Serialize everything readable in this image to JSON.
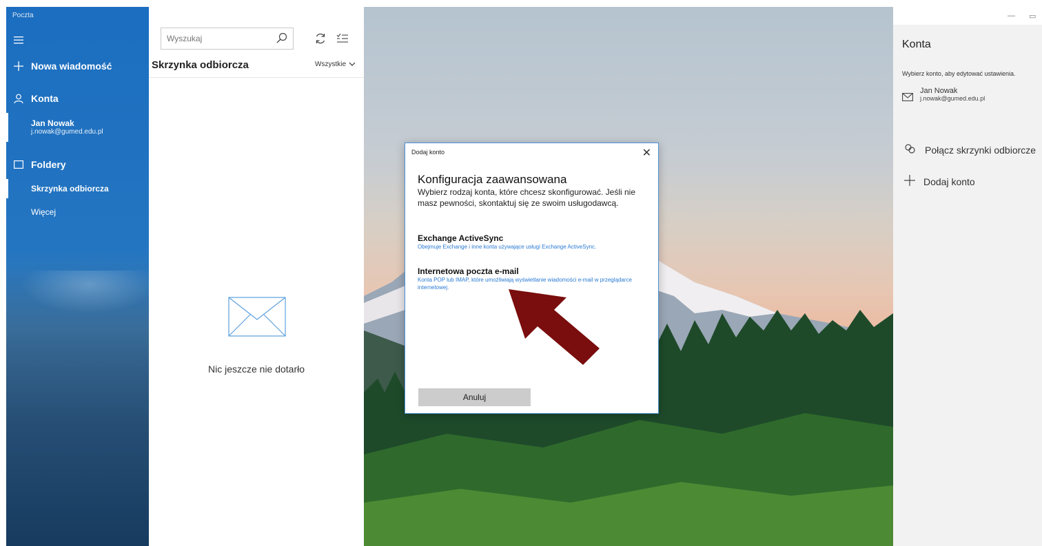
{
  "app": {
    "title": "Poczta"
  },
  "sidebar": {
    "new_message": "Nowa wiadomość",
    "accounts_label": "Konta",
    "account": {
      "name": "Jan Nowak",
      "email": "j.nowak@gumed.edu.pl"
    },
    "folders_label": "Foldery",
    "folders": [
      "Skrzynka odbiorcza",
      "Więcej"
    ]
  },
  "list": {
    "search_placeholder": "Wyszukaj",
    "inbox_title": "Skrzynka odbiorcza",
    "filter": "Wszystkie",
    "empty_text": "Nic jeszcze nie dotarło"
  },
  "dialog": {
    "title": "Dodaj konto",
    "heading": "Konfiguracja zaawansowana",
    "description": "Wybierz rodzaj konta, które chcesz skonfigurować. Jeśli nie masz pewności, skontaktuj się ze swoim usługodawcą.",
    "options": [
      {
        "title": "Exchange ActiveSync",
        "desc": "Obejmuje Exchange i inne konta używające usługi Exchange ActiveSync."
      },
      {
        "title": "Internetowa poczta e-mail",
        "desc": "Konta POP lub IMAP, które umożliwiają wyświetlanie wiadomości e-mail w przeglądarce internetowej."
      }
    ],
    "cancel": "Anuluj"
  },
  "pane": {
    "title": "Konta",
    "hint": "Wybierz konto, aby edytować ustawienia.",
    "account": {
      "name": "Jan Nowak",
      "email": "j.nowak@gumed.edu.pl"
    },
    "link_inboxes": "Połącz skrzynki odbiorcze",
    "add_account": "Dodaj konto"
  },
  "colors": {
    "accent": "#1a73c8",
    "link": "#2a7ad3",
    "arrow": "#7a0d0d",
    "dialog_border": "#4a90d9"
  },
  "icons": [
    "hamburger-icon",
    "plus-icon",
    "person-icon",
    "folder-icon",
    "search-icon",
    "sync-icon",
    "select-icon",
    "chevron-down-icon",
    "envelope-icon",
    "close-icon",
    "mail-icon",
    "link-icon"
  ]
}
